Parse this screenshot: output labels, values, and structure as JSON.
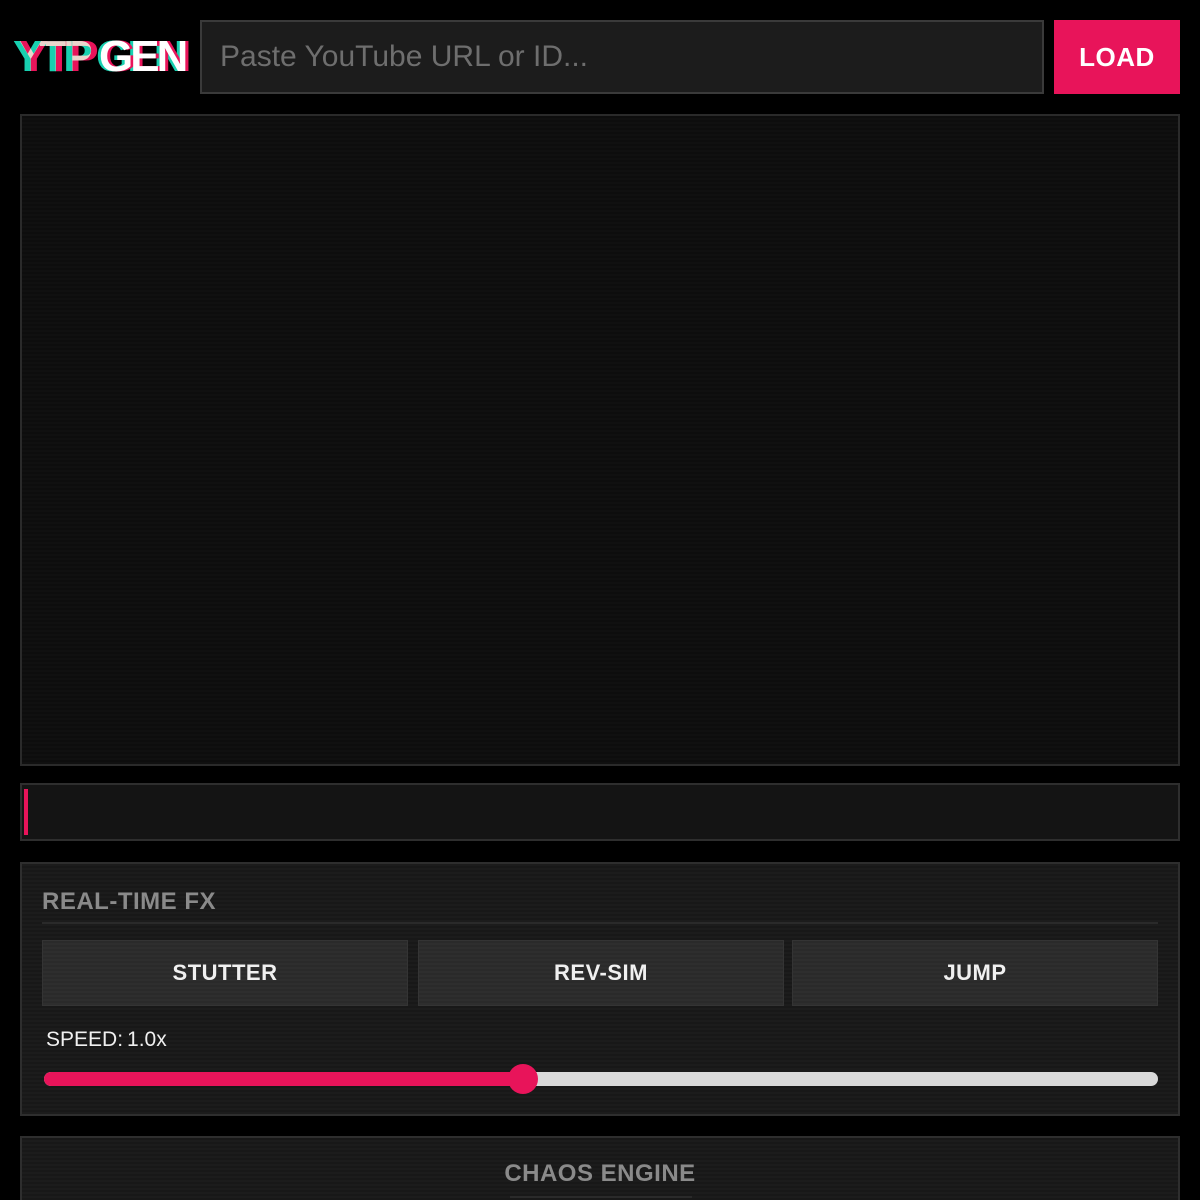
{
  "header": {
    "logo_left": "YTP",
    "logo_right": "GEN",
    "url_placeholder": "Paste YouTube URL or ID...",
    "load_label": "LOAD"
  },
  "timeline": {
    "progress": 0.0
  },
  "fx_panel": {
    "title": "REAL-TIME FX",
    "buttons": [
      "STUTTER",
      "REV-SIM",
      "JUMP"
    ],
    "speed_label": "SPEED:",
    "speed_value": "1.0x",
    "speed_level": 0.43
  },
  "chaos_panel": {
    "title": "CHAOS ENGINE"
  },
  "colors": {
    "accent": "#e8145a",
    "logo_cyan": "#18d0b0",
    "background": "#000000",
    "panel": "#181818"
  }
}
